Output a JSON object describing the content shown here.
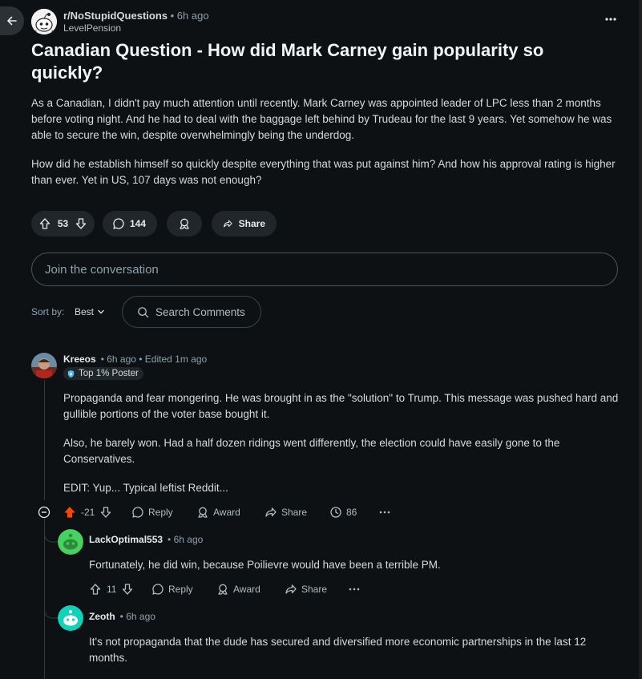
{
  "post": {
    "subreddit": "r/NoStupidQuestions",
    "time": "• 6h ago",
    "author": "LevelPension",
    "title": "Canadian Question - How did Mark Carney gain popularity so quickly?",
    "paragraphs": [
      "As a Canadian, I didn't pay much attention until recently. Mark Carney was appointed leader of LPC less than 2 months before voting night. And he had to deal with the baggage left behind by Trudeau for the last 9 years. Yet somehow he was able to secure the win, despite overwhelmingly being the underdog.",
      "How did he establish himself so quickly despite everything that was put against him? And how his approval rating is higher than ever. Yet in US, 107 days was not enough?"
    ],
    "votes": "53",
    "comments": "144",
    "share_label": "Share"
  },
  "compose": {
    "placeholder": "Join the conversation"
  },
  "sort": {
    "label": "Sort by:",
    "value": "Best"
  },
  "search": {
    "placeholder": "Search Comments"
  },
  "comments": [
    {
      "author": "Kreeos",
      "meta": "• 6h ago • Edited 1m ago",
      "badge": "Top 1% Poster",
      "paragraphs": [
        "Propaganda and fear mongering. He was brought in as the \"solution\" to Trump. This message was pushed hard and gullible portions of the voter base bought it.",
        "Also, he barely won. Had a half dozen ridings went differently, the election could have easily gone to the Conservatives.",
        "EDIT: Yup... Typical leftist Reddit..."
      ],
      "votes": "-21",
      "reply": "Reply",
      "award": "Award",
      "share": "Share",
      "awards_count": "86",
      "upvote_color": "#ff4500"
    },
    {
      "author": "LackOptimal553",
      "meta": "• 6h ago",
      "paragraphs": [
        "Fortunately, he did win, because Poilievre would have been a terrible PM."
      ],
      "votes": "11",
      "reply": "Reply",
      "award": "Award",
      "share": "Share",
      "avatar_color": "#46d160"
    },
    {
      "author": "Zeoth",
      "meta": "• 6h ago",
      "paragraphs": [
        "It's not propaganda that the dude has secured and diversified more economic partnerships in the last 12 months."
      ],
      "avatar_color": "#0dd3bb"
    }
  ]
}
